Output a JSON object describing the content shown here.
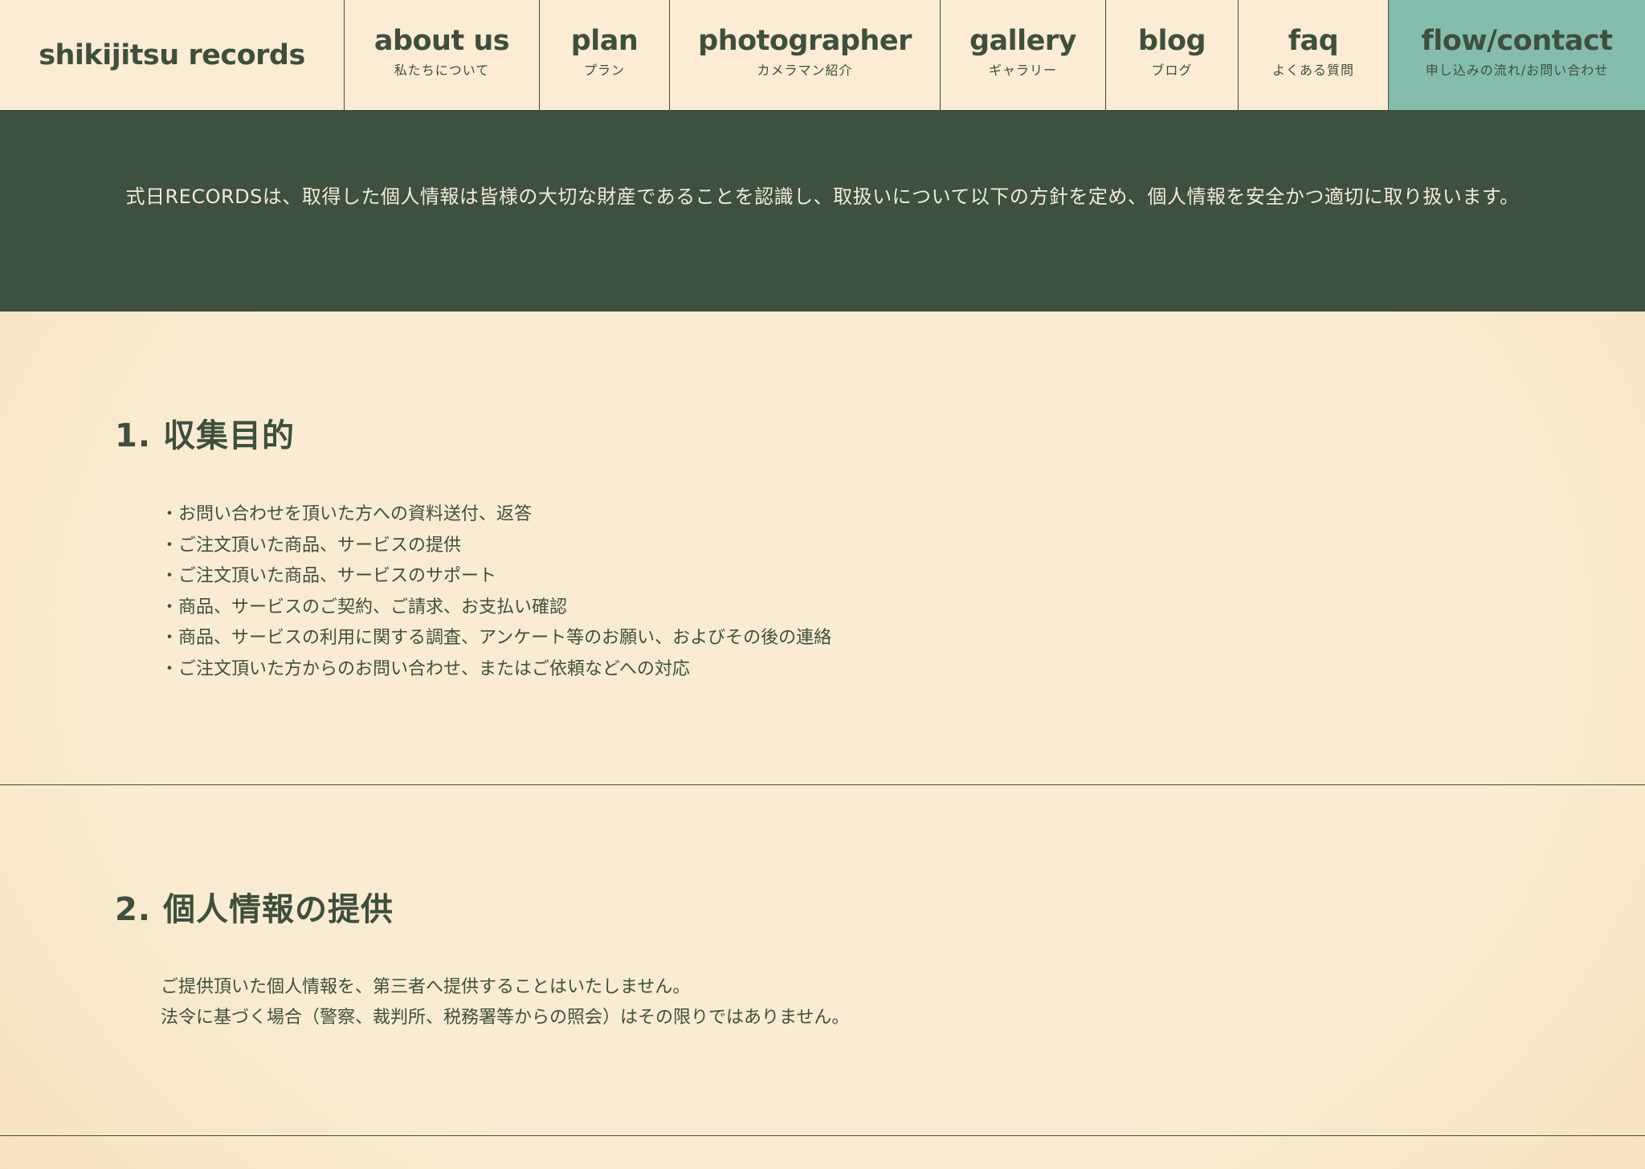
{
  "header": {
    "logo": "shikijitsu records",
    "nav": [
      {
        "en": "about us",
        "ja": "私たちについて"
      },
      {
        "en": "plan",
        "ja": "プラン"
      },
      {
        "en": "photographer",
        "ja": "カメラマン紹介"
      },
      {
        "en": "gallery",
        "ja": "ギャラリー"
      },
      {
        "en": "blog",
        "ja": "ブログ"
      },
      {
        "en": "faq",
        "ja": "よくある質問"
      },
      {
        "en": "flow/contact",
        "ja": "申し込みの流れ/お問い合わせ"
      }
    ]
  },
  "intro": {
    "text": "式日RECORDSは、取得した個人情報は皆様の大切な財産であることを認識し、取扱いについて以下の方針を定め、個人情報を安全かつ適切に取り扱います。"
  },
  "sections": [
    {
      "heading": "1. 収集目的",
      "items": [
        "・お問い合わせを頂いた方への資料送付、返答",
        "・ご注文頂いた商品、サービスの提供",
        "・ご注文頂いた商品、サービスのサポート",
        "・商品、サービスのご契約、ご請求、お支払い確認",
        "・商品、サービスの利用に関する調査、アンケート等のお願い、およびその後の連絡",
        "・ご注文頂いた方からのお問い合わせ、またはご依頼などへの対応"
      ]
    },
    {
      "heading": "2. 個人情報の提供",
      "lines": [
        "ご提供頂いた個人情報を、第三者へ提供することはいたしません。",
        "法令に基づく場合（警察、裁判所、税務署等からの照会）はその限りではありません。"
      ]
    }
  ],
  "colors": {
    "primary": "#3e4f3e",
    "accent": "#84bcae",
    "background": "#faecd2"
  }
}
